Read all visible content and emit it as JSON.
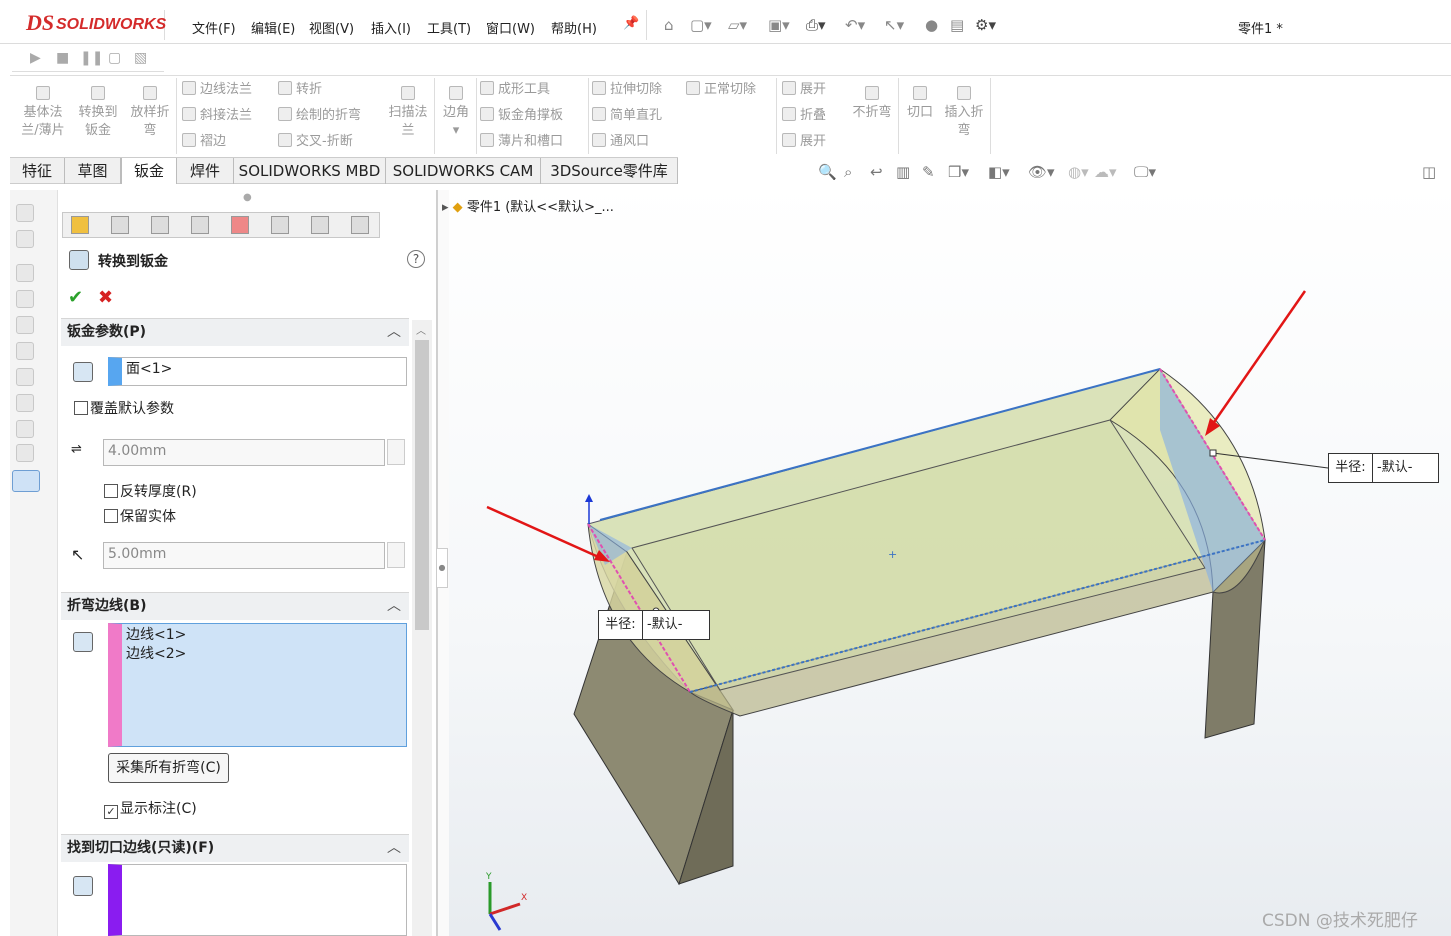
{
  "app": {
    "logo_prefix": "DS",
    "logo_name": "SOLIDWORKS",
    "doc_title": "零件1 *"
  },
  "menu": [
    "文件(F)",
    "编辑(E)",
    "视图(V)",
    "插入(I)",
    "工具(T)",
    "窗口(W)",
    "帮助(H)"
  ],
  "ribbon": {
    "big1": [
      "基体法",
      "兰/薄片"
    ],
    "big2": [
      "转换到",
      "钣金"
    ],
    "big3": [
      "放样折",
      "弯"
    ],
    "g1": [
      "边线法兰",
      "斜接法兰",
      "褶边"
    ],
    "g2": [
      "转折",
      "绘制的折弯",
      "交叉-折断"
    ],
    "big4": [
      "扫描法",
      "兰"
    ],
    "big5": [
      "边角"
    ],
    "g3": [
      "成形工具",
      "钣金角撑板",
      "薄片和槽口"
    ],
    "g4": [
      "拉伸切除",
      "简单直孔",
      "通风口"
    ],
    "g5": [
      "正常切除"
    ],
    "g6": [
      "展开",
      "折叠",
      "展开"
    ],
    "big6": [
      "不折弯"
    ],
    "big7": [
      "切口"
    ],
    "big8": [
      "插入折",
      "弯"
    ]
  },
  "tabs": [
    "特征",
    "草图",
    "钣金",
    "焊件",
    "SOLIDWORKS MBD",
    "SOLIDWORKS CAM",
    "3DSource零件库"
  ],
  "active_tab": "钣金",
  "panel": {
    "title": "转换到钣金",
    "ok": "✔",
    "cancel": "✖",
    "help": "?",
    "sec1": "钣金参数(P)",
    "face": "面<1>",
    "override": "覆盖默认参数",
    "thickness": "4.00mm",
    "reverse": "反转厚度(R)",
    "keep": "保留实体",
    "radius": "5.00mm",
    "sec2": "折弯边线(B)",
    "edges": [
      "边线<1>",
      "边线<2>"
    ],
    "collect": "采集所有折弯(C)",
    "show_labels": "显示标注(C)",
    "sec3": "找到切口边线(只读)(F)"
  },
  "tree": {
    "root": "零件1 (默认<<默认>_..."
  },
  "callouts": [
    {
      "label": "半径:",
      "value": "-默认-"
    },
    {
      "label": "半径:",
      "value": "-默认-"
    }
  ],
  "triad": {
    "x": "X",
    "y": "Y"
  },
  "watermark": "CSDN @技术死肥仔"
}
